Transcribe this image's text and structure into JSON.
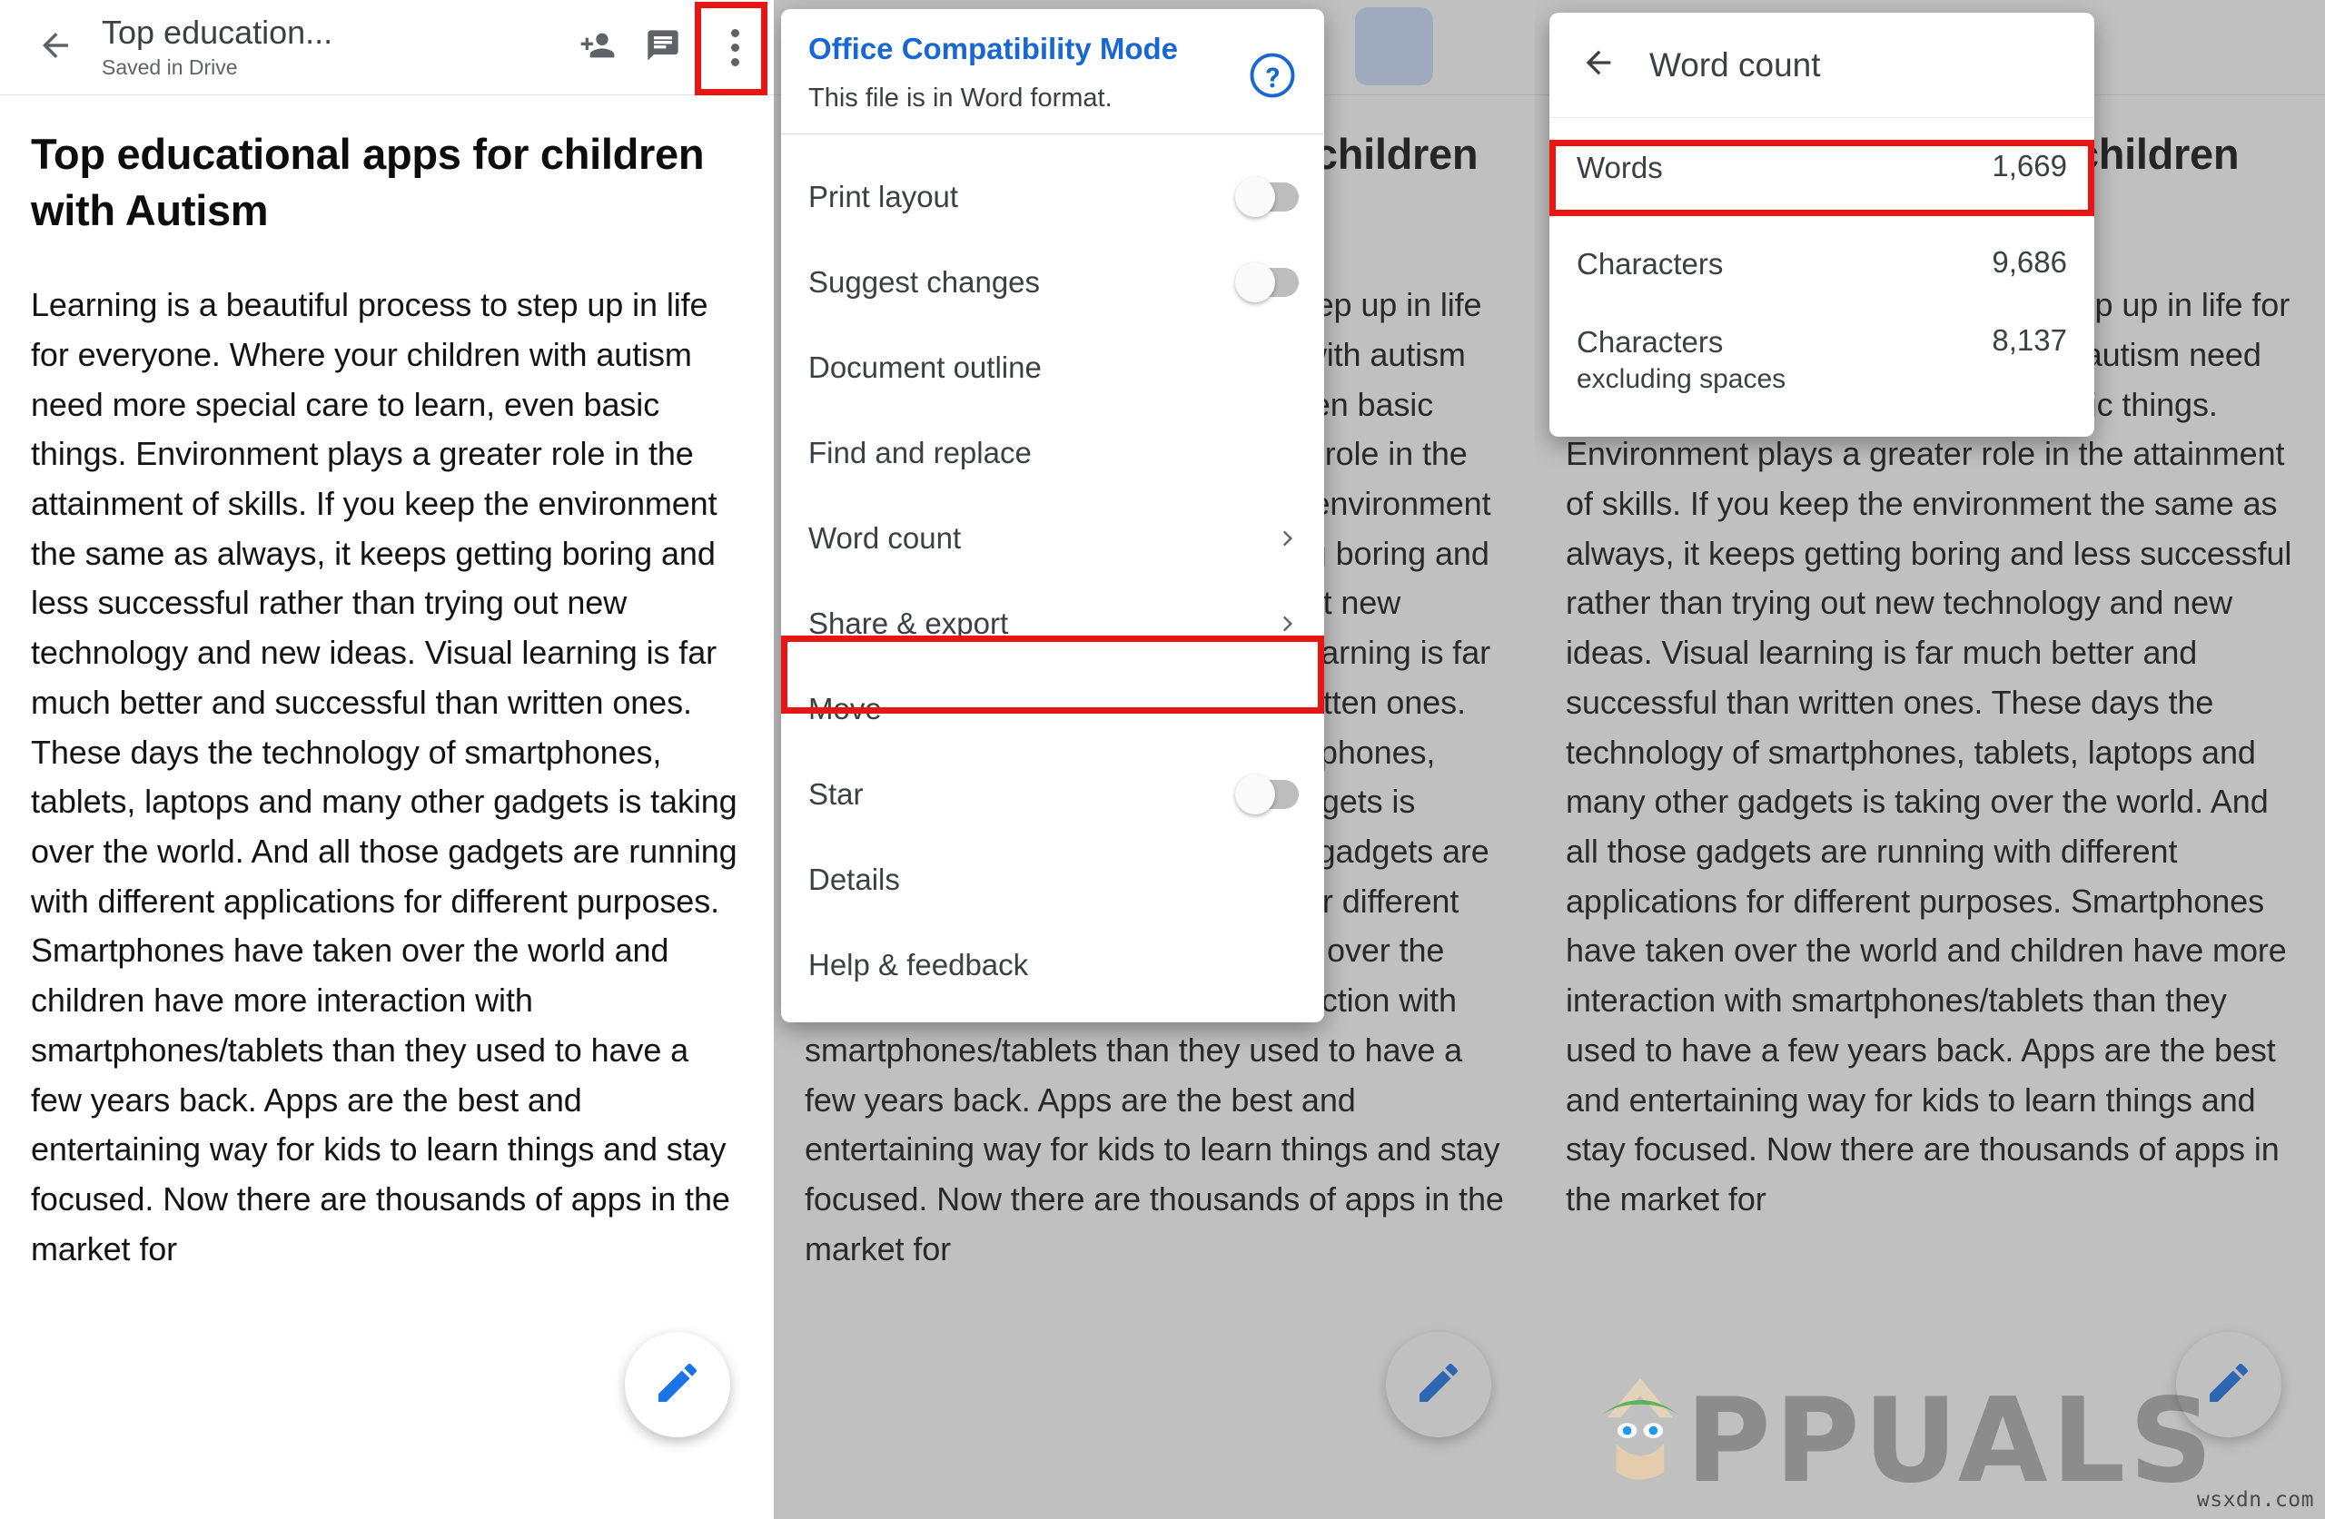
{
  "app": {
    "doc_title": "Top education...",
    "doc_subtitle": "Saved in Drive",
    "back_icon": "back-arrow-icon",
    "add_person_icon": "person-add-icon",
    "comment_icon": "comment-icon",
    "overflow_icon": "more-vert-icon",
    "fab_icon": "edit-pencil-icon"
  },
  "document": {
    "heading": "Top educational apps for children with Autism",
    "paragraph": "Learning is a beautiful process to step up in life for everyone. Where your children with autism need more special care to learn, even basic things. Environment plays a greater role in the attainment of skills. If you keep the environment the same as always, it keeps getting boring and less successful rather than trying out new technology and new ideas. Visual learning is far much better and successful than written ones. These days the technology of smartphones, tablets, laptops and many other gadgets is taking over the world. And all those gadgets are running with different applications for different purposes. Smartphones have taken over the world and children have more interaction with smartphones/tablets than they used to have a few years back. Apps are the best and entertaining way for kids to learn things and stay focused. Now there are thousands of apps in the market for"
  },
  "menu": {
    "office_mode_title": "Office Compatibility Mode",
    "office_mode_desc": "This file is in Word format.",
    "help_icon": "help-circle-icon",
    "items": [
      {
        "label": "Print layout",
        "control": "toggle",
        "state": "off",
        "icon": ""
      },
      {
        "label": "Suggest changes",
        "control": "toggle",
        "state": "off",
        "icon": ""
      },
      {
        "label": "Document outline",
        "control": "none",
        "state": "",
        "icon": ""
      },
      {
        "label": "Find and replace",
        "control": "none",
        "state": "",
        "icon": ""
      },
      {
        "label": "Word count",
        "control": "chevron",
        "state": "",
        "icon": "chevron-right-icon"
      },
      {
        "label": "Share & export",
        "control": "chevron",
        "state": "",
        "icon": "chevron-right-icon"
      },
      {
        "label": "Move",
        "control": "none",
        "state": "",
        "icon": ""
      },
      {
        "label": "Star",
        "control": "toggle",
        "state": "off",
        "icon": ""
      },
      {
        "label": "Details",
        "control": "none",
        "state": "",
        "icon": ""
      },
      {
        "label": "Help & feedback",
        "control": "none",
        "state": "",
        "icon": ""
      }
    ]
  },
  "word_count": {
    "title": "Word count",
    "back_icon": "back-arrow-icon",
    "rows": [
      {
        "label": "Words",
        "sublabel": "",
        "value": "1,669"
      },
      {
        "label": "Characters",
        "sublabel": "",
        "value": "9,686"
      },
      {
        "label": "Characters",
        "sublabel": "excluding spaces",
        "value": "8,137"
      }
    ]
  },
  "annotations": {
    "highlight_color": "#e81515",
    "targets": [
      "overflow-menu-button",
      "word-count-menu-item",
      "words-row"
    ]
  },
  "watermark": {
    "brand": "PPUALS",
    "site": "wsxdn.com"
  },
  "colors": {
    "accent_blue": "#1967d2",
    "fab_blue": "#1a73e8",
    "text_primary": "#3c4043",
    "text_secondary": "#5f6368",
    "scrim": "#808080"
  }
}
